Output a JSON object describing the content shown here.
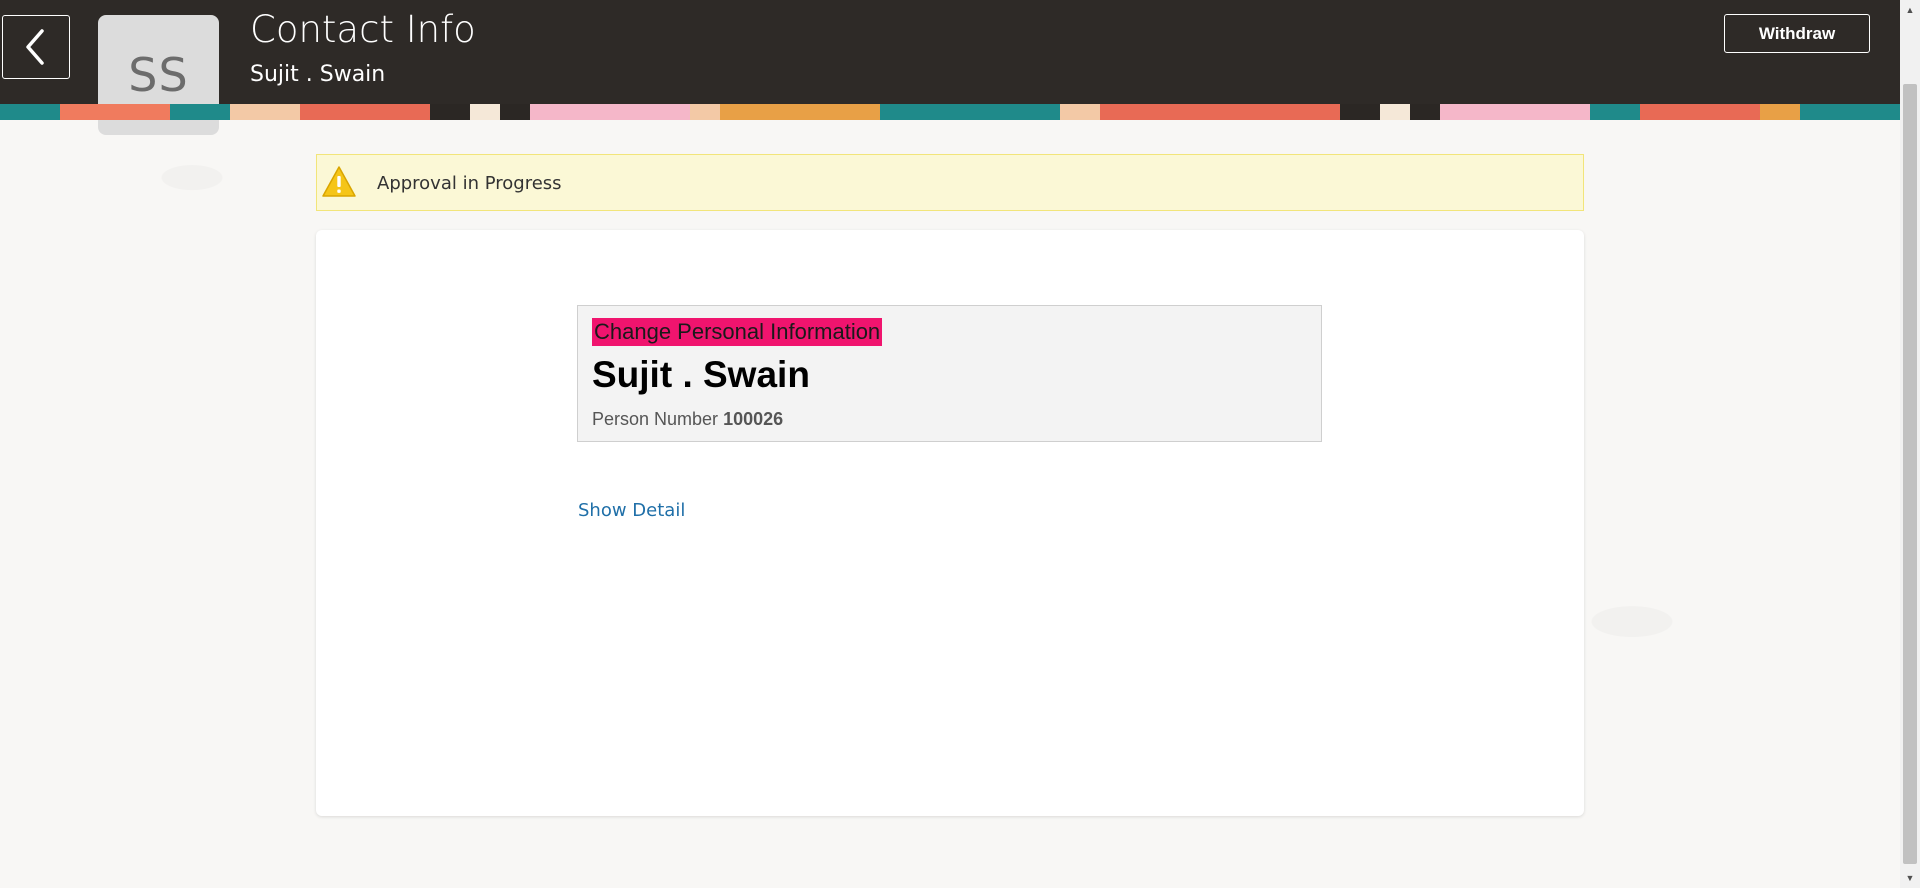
{
  "header": {
    "title": "Contact Info",
    "subtitle": "Sujit . Swain",
    "avatar_initials": "SS",
    "back_icon": "chevron-left-icon",
    "withdraw_label": "Withdraw"
  },
  "alert": {
    "icon": "warning-icon",
    "text": "Approval in Progress"
  },
  "card": {
    "change_label": "Change Personal Information",
    "person_name": "Sujit . Swain",
    "person_number_label": "Person Number",
    "person_number_value": "100026",
    "show_detail_label": "Show Detail"
  },
  "colors": {
    "header_bg": "#2e2a27",
    "alert_bg": "#fbf8d6",
    "highlight": "#f0146e",
    "link": "#1f6fa8"
  }
}
